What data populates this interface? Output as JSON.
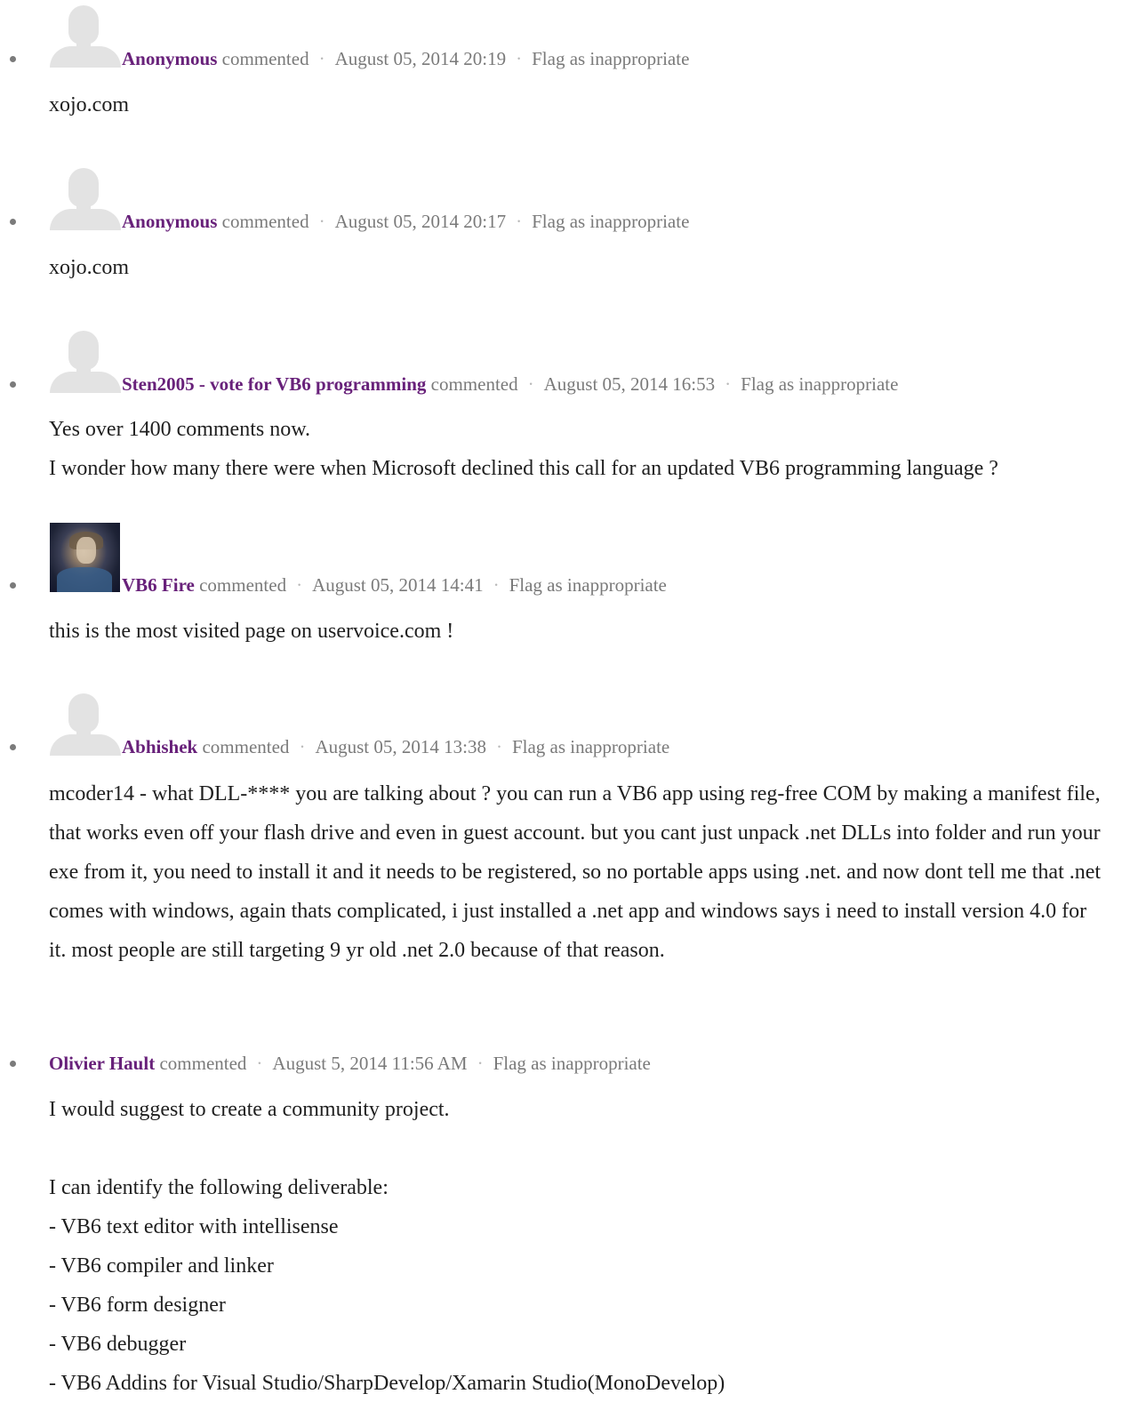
{
  "comments": [
    {
      "author": "Anonymous",
      "commented_label": "commented",
      "date": "August 05, 2014 20:19",
      "flag_label": "Flag as inappropriate",
      "body": "xojo.com",
      "avatar": "person-placeholder-icon"
    },
    {
      "author": "Anonymous",
      "commented_label": "commented",
      "date": "August 05, 2014 20:17",
      "flag_label": "Flag as inappropriate",
      "body": "xojo.com",
      "avatar": "person-placeholder-icon"
    },
    {
      "author": "Sten2005 - vote for VB6 programming",
      "commented_label": "commented",
      "date": "August 05, 2014 16:53",
      "flag_label": "Flag as inappropriate",
      "body": "Yes over 1400 comments now.\nI wonder how many there were when Microsoft declined this call for an updated VB6 programming language ?",
      "avatar": "person-placeholder-icon"
    },
    {
      "author": "VB6 Fire",
      "commented_label": "commented",
      "date": "August 05, 2014 14:41",
      "flag_label": "Flag as inappropriate",
      "body": "this is the most visited page on uservoice.com !",
      "avatar": "user-photo"
    },
    {
      "author": "Abhishek",
      "commented_label": "commented",
      "date": "August 05, 2014 13:38",
      "flag_label": "Flag as inappropriate",
      "body": "mcoder14 - what DLL-**** you are talking about ? you can run a VB6 app using reg-free COM by making a manifest file, that works even off your flash drive and even in guest account. but you cant just unpack .net DLLs into folder and run your exe from it, you need to install it and it needs to be registered, so no portable apps using .net. and now dont tell me that .net comes with windows, again thats complicated, i just installed a .net app and windows says i need to install version 4.0 for it. most people are still targeting 9 yr old .net 2.0 because of that reason.",
      "avatar": "person-placeholder-icon"
    },
    {
      "author": "Olivier Hault",
      "commented_label": "commented",
      "date": "August 5, 2014 11:56 AM",
      "flag_label": "Flag as inappropriate",
      "body": "I would suggest to create a community project.\n\nI can identify the following deliverable:\n- VB6 text editor with intellisense\n- VB6 compiler and linker\n- VB6 form designer\n- VB6 debugger\n- VB6 Addins for Visual Studio/SharpDevelop/Xamarin Studio(MonoDevelop)",
      "avatar": "none"
    }
  ],
  "colors": {
    "author": "#68217a",
    "meta": "#7a7a7a",
    "body": "#1f1f1f",
    "bullet": "#7b7b7b",
    "avatar_placeholder": "#e3e3e3"
  }
}
